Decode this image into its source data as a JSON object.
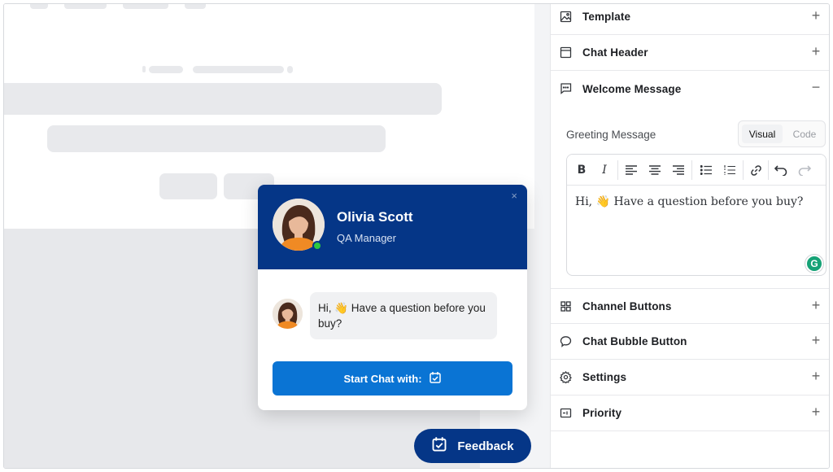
{
  "widget": {
    "agent_name": "Olivia Scott",
    "agent_role": "QA Manager",
    "message": "Hi, 👋 Have a question before you buy?",
    "start_button": "Start Chat with:",
    "close_symbol": "×"
  },
  "feedback_button": "Feedback",
  "panel": {
    "sections": [
      {
        "label": "Template",
        "icon": "image-icon",
        "toggle": "+"
      },
      {
        "label": "Chat Header",
        "icon": "window-icon",
        "toggle": "+"
      },
      {
        "label": "Welcome Message",
        "icon": "message-icon",
        "toggle": "−"
      },
      {
        "label": "Channel Buttons",
        "icon": "grid-icon",
        "toggle": "+"
      },
      {
        "label": "Chat Bubble Button",
        "icon": "chat-bubble-icon",
        "toggle": "+"
      },
      {
        "label": "Settings",
        "icon": "gear-icon",
        "toggle": "+"
      },
      {
        "label": "Priority",
        "icon": "priority-icon",
        "toggle": "+"
      }
    ],
    "greeting_label": "Greeting Message",
    "mode_visual": "Visual",
    "mode_code": "Code",
    "editor_text": "Hi, 👋 Have a question before you buy?",
    "grammarly_badge": "G"
  },
  "colors": {
    "header_blue": "#053687",
    "button_blue": "#0a74d4",
    "online_green": "#2ec93f"
  }
}
